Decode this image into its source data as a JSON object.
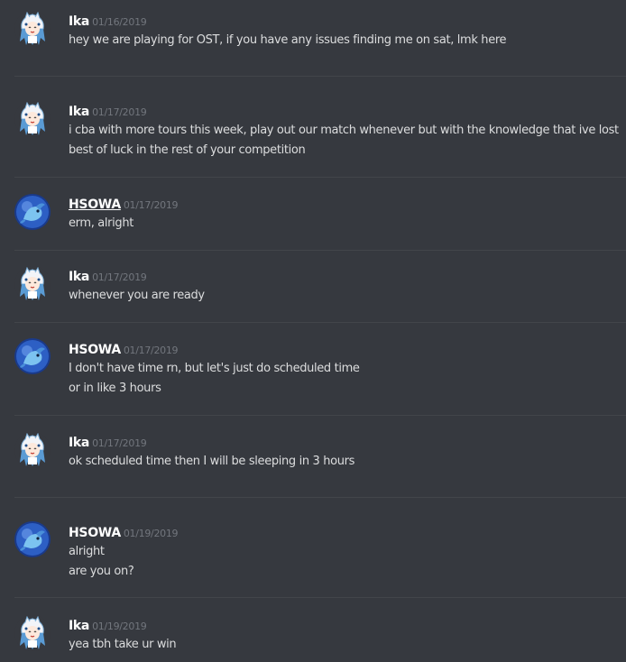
{
  "messages": [
    {
      "author": "Ika",
      "timestamp": "01/16/2019",
      "lines": [
        "hey we are playing for OST, if you have any issues finding me on sat, lmk here"
      ]
    },
    {
      "author": "Ika",
      "timestamp": "01/17/2019",
      "lines": [
        "i cba with more tours this week, play out our match whenever but with the knowledge that ive lost",
        "best of luck in the rest of your competition"
      ]
    },
    {
      "author": "HSOWA",
      "timestamp": "01/17/2019",
      "lines": [
        "erm, alright"
      ]
    },
    {
      "author": "Ika",
      "timestamp": "01/17/2019",
      "lines": [
        "whenever you are ready"
      ]
    },
    {
      "author": "HSOWA",
      "timestamp": "01/17/2019",
      "lines": [
        "I don't have time rn, but let's just do scheduled time",
        "or in like 3 hours"
      ]
    },
    {
      "author": "Ika",
      "timestamp": "01/17/2019",
      "lines": [
        "ok scheduled time then I will be sleeping in 3 hours"
      ]
    },
    {
      "author": "HSOWA",
      "timestamp": "01/19/2019",
      "lines": [
        "alright",
        "are you on?"
      ]
    },
    {
      "author": "Ika",
      "timestamp": "01/19/2019",
      "lines": [
        "yea tbh take ur win"
      ]
    }
  ],
  "colors": {
    "background": "#36393f",
    "author": "#ffffff",
    "timestamp": "#72767d",
    "text": "#dcddde",
    "divider": "#42454a"
  },
  "icons": {
    "ika_avatar": "squid-girl-avatar-icon",
    "hsowa_avatar": "blue-dragon-avatar-icon"
  }
}
